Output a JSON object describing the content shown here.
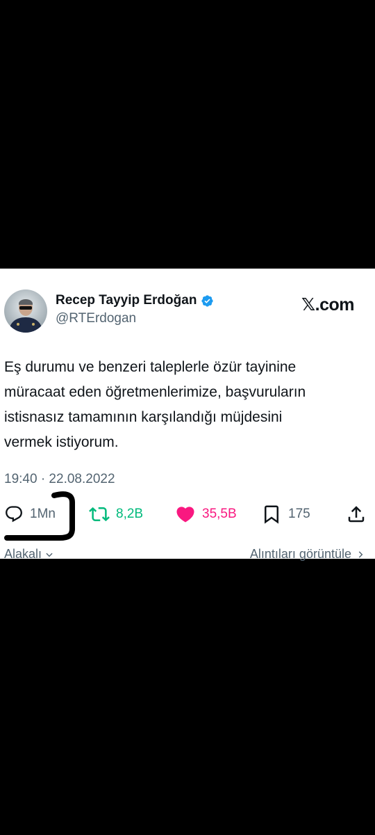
{
  "tweet": {
    "author_name": "Recep Tayyip Erdoğan",
    "handle": "@RTErdogan",
    "site_logo": ".com",
    "text_lines": [
      "Eş durumu ve benzeri taleplerle özür tayinine",
      "müracaat eden öğretmenlerimize, başvuruların",
      "istisnasız tamamının karşılandığı müjdesini",
      "vermek istiyorum."
    ],
    "timestamp": "19:40 · 22.08.2022"
  },
  "actions": {
    "replies": "1Mn",
    "retweets": "8,2B",
    "likes": "35,5B",
    "bookmarks": "175"
  },
  "footer": {
    "left_label": "Alakalı",
    "right_label": "Alıntıları görüntüle"
  },
  "colors": {
    "retweet_green": "#00ba7c",
    "like_pink": "#f91880",
    "verified_blue": "#1d9bf0",
    "secondary_gray": "#536471",
    "text_black": "#0f1419"
  }
}
